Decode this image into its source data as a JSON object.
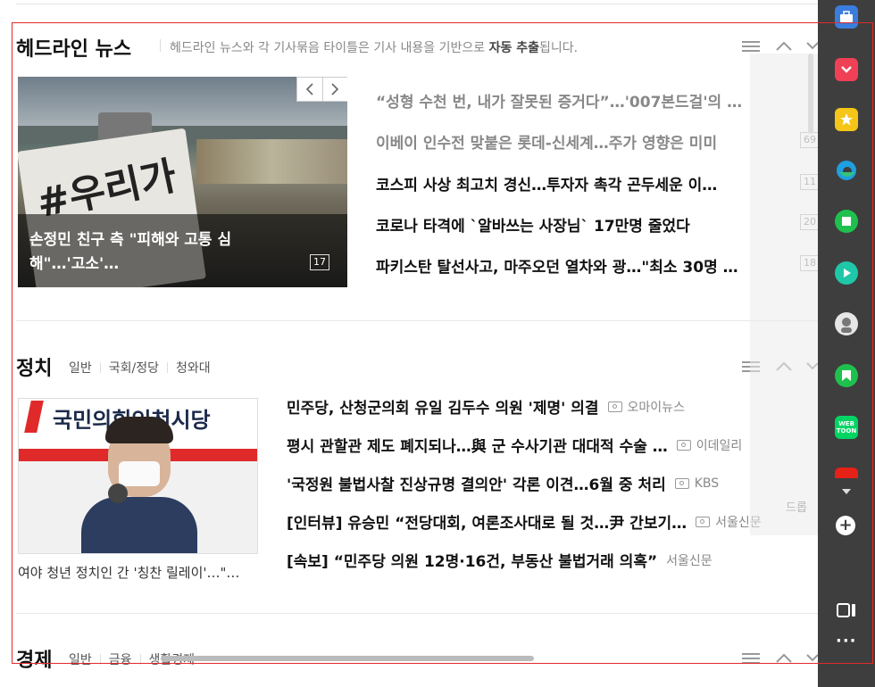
{
  "headline": {
    "title": "헤드라인 뉴스",
    "desc_prefix": "헤드라인 뉴스와 각 기사묶음 타이틀은 기사 내용을 기반으로 ",
    "desc_bold": "자동 추출",
    "desc_suffix": "됩니다.",
    "photo": {
      "caption_line1": "손정민 친구 측 \"피해와 고통 심",
      "caption_line2": "해\"…'고소'…",
      "count": "17"
    },
    "items": [
      {
        "title": "“성형 수천 번, 내가 잘못된 증거다”…'007본드걸'의 …",
        "count": ""
      },
      {
        "title": "이베이 인수전 맞붙은 롯데-신세계…주가 영향은 미미",
        "count": "69"
      },
      {
        "title": "코스피 사상 최고치 경신…투자자 촉각 곤두세운 이…",
        "count": "11"
      },
      {
        "title": "코로나 타격에 `알바쓰는 사장님` 17만명 줄었다",
        "count": "20"
      },
      {
        "title": "파키스탄 탈선사고, 마주오던 열차와 광…\"최소 30명 …",
        "count": "18"
      }
    ]
  },
  "politics": {
    "title": "정치",
    "sublinks": [
      "일반",
      "국회/정당",
      "청와대"
    ],
    "photo": {
      "sign_text": "국민의힘인천시당",
      "caption": "여야 청년 정치인 간 '칭찬 릴레이'…\"…"
    },
    "items": [
      {
        "title": "민주당, 산청군의회 유일 김두수 의원 '제명' 의결",
        "source": "오마이뉴스",
        "photo": true
      },
      {
        "title": "평시 관할관 제도 폐지되나…與 군 수사기관 대대적 수술 …",
        "source": "이데일리",
        "photo": true
      },
      {
        "title": "'국정원 불법사찰 진상규명 결의안' 각론 이견…6월 중 처리",
        "source": "KBS",
        "photo": true
      },
      {
        "title": "[인터뷰] 유승민 “전당대회, 여론조사대로 될 것…尹 간보기…",
        "source": "서울신문",
        "photo": true
      },
      {
        "title": "[속보] “민주당 의원 12명·16건, 부동산 불법거래 의혹”",
        "source": "서울신문",
        "photo": false
      }
    ]
  },
  "economy": {
    "title": "경제",
    "sublinks": [
      "일반",
      "금융",
      "생활경제"
    ]
  },
  "sidebar": {
    "icons": [
      "toolbox-icon",
      "pocket-icon",
      "star-icon",
      "edge-icon",
      "green-square-icon",
      "play-icon",
      "avatar-icon",
      "bookmark-icon",
      "webtoon-icon",
      "youtube-icon"
    ],
    "webtoon_label": "WEB TOON",
    "more_label": "···",
    "plus_label": "+",
    "tooltip": "드롭"
  },
  "colors": {
    "accent_red": "#e02a2a",
    "sidebar_bg": "#3e3e3e"
  }
}
